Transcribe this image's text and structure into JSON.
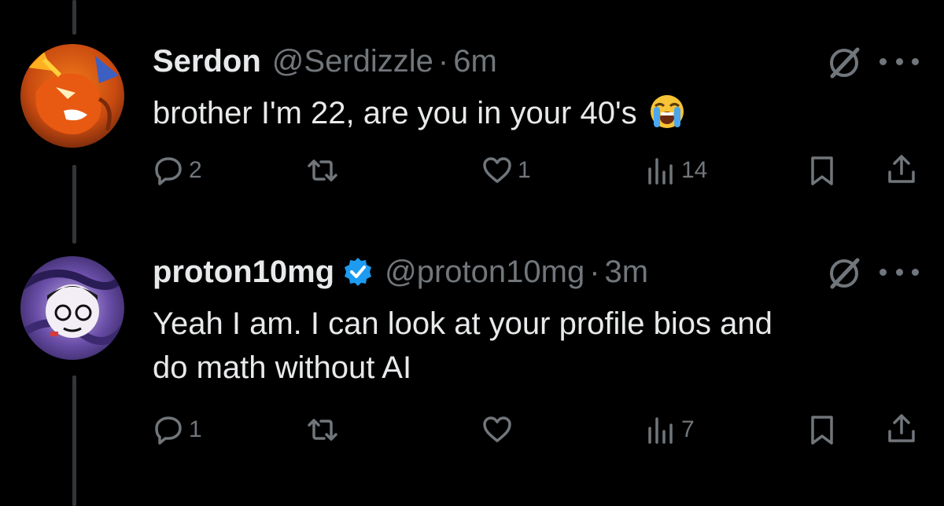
{
  "thread": {
    "tweets": [
      {
        "name": "Serdon",
        "verified": false,
        "handle": "@Serdizzle",
        "separator": "·",
        "time": "6m",
        "text": "brother I'm 22, are you in your 40's",
        "emoji": "loudly-crying-face",
        "avatar_icon": "orange-monster-avatar",
        "actions": {
          "replies": "2",
          "reposts": "",
          "likes": "1",
          "views": "14"
        }
      },
      {
        "name": "proton10mg",
        "verified": true,
        "handle": "@proton10mg",
        "separator": "·",
        "time": "3m",
        "text_line1": "Yeah I am. I can look at your profile bios and",
        "text_line2": "do math without AI",
        "avatar_icon": "purple-swirl-cartoon-avatar",
        "actions": {
          "replies": "1",
          "reposts": "",
          "likes": "",
          "views": "7"
        }
      }
    ]
  },
  "colors": {
    "background": "#000000",
    "text_primary": "#e7e9ea",
    "text_secondary": "#71767b",
    "verified_badge": "#1d9bf0",
    "thread_line": "#333639"
  },
  "icons": [
    "reply-icon",
    "repost-icon",
    "like-icon",
    "views-icon",
    "bookmark-icon",
    "share-icon",
    "grok-icon",
    "more-icon",
    "verified-badge-icon"
  ]
}
